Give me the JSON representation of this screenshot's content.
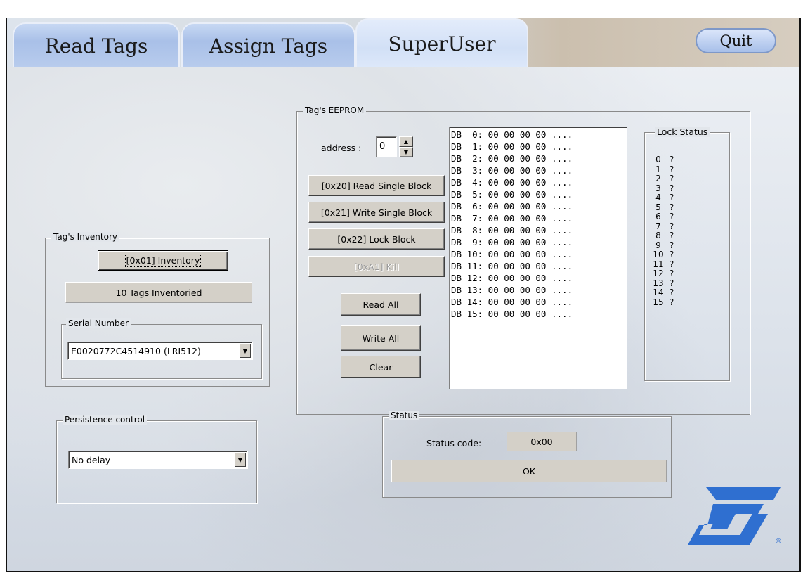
{
  "tabs": [
    {
      "label": "Read Tags",
      "active": false
    },
    {
      "label": "Assign Tags",
      "active": false
    },
    {
      "label": "SuperUser",
      "active": true
    }
  ],
  "quit_label": "Quit",
  "inventory": {
    "group_label": "Tag's Inventory",
    "button_label": "[0x01] Inventory",
    "count_text": "10 Tags Inventoried",
    "serial_group_label": "Serial Number",
    "serial_value": "E0020772C4514910 (LRI512)"
  },
  "persistence": {
    "group_label": "Persistence control",
    "value": "No delay"
  },
  "eeprom": {
    "group_label": "Tag's EEPROM",
    "address_label": "address :",
    "address_value": "0",
    "buttons": {
      "read_single": "[0x20] Read Single Block",
      "write_single": "[0x21] Write Single Block",
      "lock_block": "[0x22] Lock Block",
      "kill": "[0xA1] Kill",
      "read_all": "Read All",
      "write_all": "Write All",
      "clear": "Clear"
    },
    "blocks": [
      "DB  0: 00 00 00 00 ....",
      "DB  1: 00 00 00 00 ....",
      "DB  2: 00 00 00 00 ....",
      "DB  3: 00 00 00 00 ....",
      "DB  4: 00 00 00 00 ....",
      "DB  5: 00 00 00 00 ....",
      "DB  6: 00 00 00 00 ....",
      "DB  7: 00 00 00 00 ....",
      "DB  8: 00 00 00 00 ....",
      "DB  9: 00 00 00 00 ....",
      "DB 10: 00 00 00 00 ....",
      "DB 11: 00 00 00 00 ....",
      "DB 12: 00 00 00 00 ....",
      "DB 13: 00 00 00 00 ....",
      "DB 14: 00 00 00 00 ....",
      "DB 15: 00 00 00 00 ...."
    ],
    "lock_status": {
      "label": "Lock Status",
      "rows": [
        {
          "n": "0",
          "s": "?"
        },
        {
          "n": "1",
          "s": "?"
        },
        {
          "n": "2",
          "s": "?"
        },
        {
          "n": "3",
          "s": "?"
        },
        {
          "n": "4",
          "s": "?"
        },
        {
          "n": "5",
          "s": "?"
        },
        {
          "n": "6",
          "s": "?"
        },
        {
          "n": "7",
          "s": "?"
        },
        {
          "n": "8",
          "s": "?"
        },
        {
          "n": "9",
          "s": "?"
        },
        {
          "n": "10",
          "s": "?"
        },
        {
          "n": "11",
          "s": "?"
        },
        {
          "n": "12",
          "s": "?"
        },
        {
          "n": "13",
          "s": "?"
        },
        {
          "n": "14",
          "s": "?"
        },
        {
          "n": "15",
          "s": "?"
        }
      ]
    }
  },
  "status": {
    "group_label": "Status",
    "code_label": "Status code:",
    "code_value": "0x00",
    "message": "OK"
  },
  "logo": {
    "name": "st-logo",
    "color": "#2f6fd0",
    "mark": "®"
  }
}
